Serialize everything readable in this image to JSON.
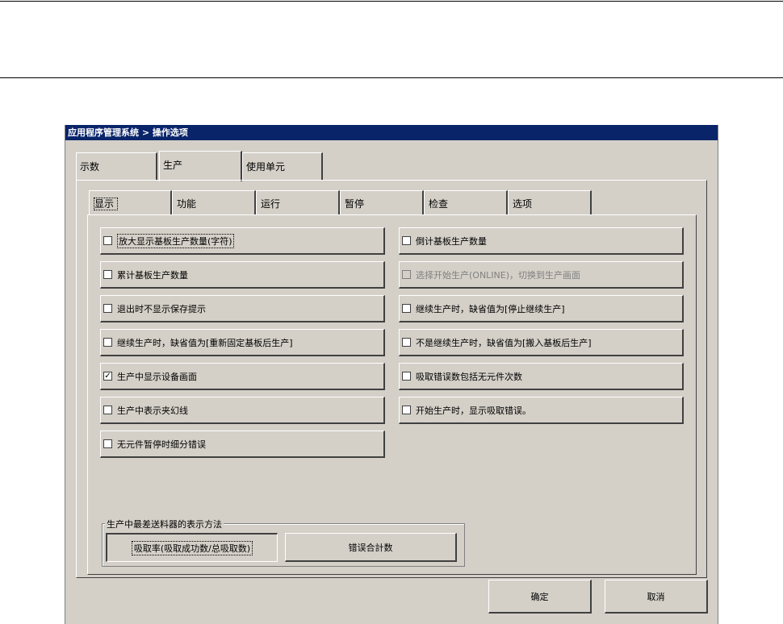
{
  "window": {
    "title": "应用程序管理系统 > 操作选项"
  },
  "outer_tabs": [
    {
      "label": "示数",
      "selected": false
    },
    {
      "label": "生产",
      "selected": true
    },
    {
      "label": "使用单元",
      "selected": false
    }
  ],
  "inner_tabs": [
    {
      "label": "显示",
      "selected": true
    },
    {
      "label": "功能",
      "selected": false
    },
    {
      "label": "运行",
      "selected": false
    },
    {
      "label": "暂停",
      "selected": false
    },
    {
      "label": "检查",
      "selected": false
    },
    {
      "label": "选项",
      "selected": false
    }
  ],
  "options_left": [
    {
      "label": "放大显示基板生产数量(字符)",
      "checked": false
    },
    {
      "label": "累计基板生产数量",
      "checked": false
    },
    {
      "label": "退出时不显示保存提示",
      "checked": false
    },
    {
      "label": "继续生产时，缺省值为[重新固定基板后生产]",
      "checked": false
    },
    {
      "label": "生产中显示设备画面",
      "checked": true
    },
    {
      "label": "生产中表示夹幻线",
      "checked": false
    },
    {
      "label": "无元件暂停时细分错误",
      "checked": false
    }
  ],
  "options_right": [
    {
      "label": "倒计基板生产数量",
      "checked": false
    },
    {
      "label": "选择开始生产(ONLINE)，切换到生产画面",
      "checked": false,
      "disabled": true
    },
    {
      "label": "继续生产时，缺省值为[停止继续生产]",
      "checked": false
    },
    {
      "label": "不是继续生产时，缺省值为[搬入基板后生产]",
      "checked": false
    },
    {
      "label": "吸取错误数包括无元件次数",
      "checked": false
    },
    {
      "label": "开始生产时，显示吸取错误。",
      "checked": false
    }
  ],
  "feeder_group": {
    "label": "生产中最差送料器的表示方法",
    "btn_rate": "吸取率(吸取成功数/总吸取数)",
    "btn_total": "错误合計数"
  },
  "footer": {
    "ok": "确定",
    "cancel": "取消"
  }
}
